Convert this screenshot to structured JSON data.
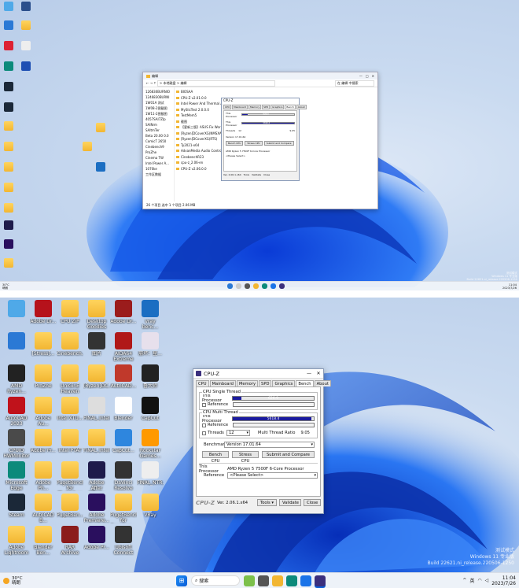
{
  "top_screen": {
    "explorer": {
      "title": "编辑",
      "breadcrumb": "> 本地磁盘 > 编辑",
      "search": "在 编辑 中搜索",
      "status": "26 个项目 选中 1 个项目 2.06 MB",
      "folders": [
        "BIOSAA",
        "CPU-Z v2.01.0.0",
        "Intel Power And Thermal Analysis Tool",
        "MySlicTest 2.0.0.0",
        "TestMem5",
        "截图",
        "【更新三版】ASUS Fix Workspace",
        "[Ryzen]DCoverXG(NMSXAfterburner)",
        "[Ryzen]DCoverXG(RTS)",
        "Ty2021-x64",
        "AdvanMedia Audio Control Panel",
        "CinebenchR23",
        "cpu-z_2.06-en",
        "CPU-Z v2.06.0.0"
      ],
      "sidebar": [
        "126830BURNIO",
        "1246830BURNI",
        "1W01A 测试",
        "1W08-2图截图",
        "1W11-2图截图",
        "4057SAI7ZIp",
        "SAlNrm",
        "SAltmTer",
        "Beta 20.00 0.0",
        "ComicT 2650",
        "Cinebench9",
        "ProZhe",
        "Cinema TW",
        "Intel Power A...",
        "1070ke",
        "工作区数据"
      ]
    },
    "mini_cpuz": {
      "title": "CPU-Z",
      "tabs": [
        "CPU",
        "Mainboard",
        "Memory",
        "SPD",
        "Graphics",
        "Bench",
        "About"
      ],
      "single_value": "626.9",
      "multi_value": "5816.4",
      "threads": "12",
      "ratio": "9.05",
      "benchmark": "Version 17.01.64",
      "buttons": [
        "Bench CPU",
        "Stress CPU",
        "Submit and Compare"
      ],
      "processor": "AMD Ryzen 5 7500F 6-Core Processor",
      "reference": "<Please Select>",
      "version": "Ver. 2.06.1.x64",
      "tools": "Tools",
      "validate": "Validate",
      "close": "Close"
    },
    "watermark": {
      "line1": "测试模式",
      "line2": "Windows 11 专业版",
      "line3": "Build 22621.ni_release.220506-1250"
    },
    "clock": {
      "time": "11:04",
      "date": "2023/7/26"
    },
    "weather": {
      "temp": "30°C",
      "desc": "晴朗"
    }
  },
  "bottom_screen": {
    "desktop_icons": [
      {
        "label": "",
        "color": "#4fa9e8"
      },
      {
        "label": "Adobe Dr...",
        "color": "#b6121b"
      },
      {
        "label": "CPU ZIP",
        "color": "folder"
      },
      {
        "label": "Desktop Goodies",
        "color": "folder"
      },
      {
        "label": "Adobe Dr...",
        "color": "#9b1c1c"
      },
      {
        "label": "vray benc...",
        "color": "#1b6ec2"
      },
      {
        "label": "",
        "color": "#2b79d5"
      },
      {
        "label": "[Stress]...",
        "color": "folder"
      },
      {
        "label": "Cinebench...",
        "color": "folder"
      },
      {
        "label": "图片",
        "color": "#333"
      },
      {
        "label": "AIDA64 Extreme",
        "color": "#b01818"
      },
      {
        "label": "崩坏：星...",
        "color": "#e7e0ec"
      },
      {
        "label": "AMD Ryzen...",
        "color": "#222"
      },
      {
        "label": "ProZhe",
        "color": "folder"
      },
      {
        "label": "UniGinE Heaven",
        "color": "folder"
      },
      {
        "label": "[Ryzen]DC...",
        "color": "folder"
      },
      {
        "label": "AutoCAD...",
        "color": "#c0392b"
      },
      {
        "label": "鲁大师",
        "color": "#222"
      },
      {
        "label": "AutoCAD 2023",
        "color": "#c0121b"
      },
      {
        "label": "Adobe Au...",
        "color": "folder"
      },
      {
        "label": "Intel XTU...",
        "color": "folder"
      },
      {
        "label": "FINAL_Intel...",
        "color": "#ddd"
      },
      {
        "label": "Blender",
        "color": "#fff"
      },
      {
        "label": "CapCut",
        "color": "#111"
      },
      {
        "label": "CPUID HWMonitor",
        "color": "#4a4a4a"
      },
      {
        "label": "Adobe Pr...",
        "color": "folder"
      },
      {
        "label": "Intel PTAT",
        "color": "folder"
      },
      {
        "label": "FINAL_Intel...",
        "color": "folder"
      },
      {
        "label": "CapCut...",
        "color": "#2e86de"
      },
      {
        "label": "Rockstar Games...",
        "color": "#ff9900"
      },
      {
        "label": "Microsoft Edge",
        "color": "#0c8a7b"
      },
      {
        "label": "Adobe Ph...",
        "color": "folder"
      },
      {
        "label": "PugetBench for Photoshop",
        "color": "folder"
      },
      {
        "label": "Adobe After Effects 2022",
        "color": "#1e1b4b"
      },
      {
        "label": "DaVinci Resolve",
        "color": "#333"
      },
      {
        "label": "FINAL_NTR...",
        "color": "#eee"
      },
      {
        "label": "Steam",
        "color": "#1b2838"
      },
      {
        "label": "AutoCAD B...",
        "color": "folder"
      },
      {
        "label": "PugetBen...",
        "color": "folder"
      },
      {
        "label": "Adobe Premiere...",
        "color": "#2a0f5e"
      },
      {
        "label": "PugetBench for Premiere...",
        "color": "folder"
      },
      {
        "label": "VRay",
        "color": "folder"
      },
      {
        "label": "Adobe Lightroom",
        "color": "folder"
      },
      {
        "label": "Blender Ben...",
        "color": "folder"
      },
      {
        "label": "RAR Archive",
        "color": "#8b1c1c"
      },
      {
        "label": "Adobe Pr...",
        "color": "#2a0f5e"
      },
      {
        "label": "Ubisoft Connect",
        "color": "#333"
      }
    ],
    "cpuz": {
      "title": "CPU-Z",
      "tabs": [
        "CPU",
        "Mainboard",
        "Memory",
        "SPD",
        "Graphics",
        "Bench",
        "About"
      ],
      "active_tab": "Bench",
      "single_group": "CPU Single Thread",
      "multi_group": "CPU Multi Thread",
      "this_processor": "This Processor",
      "reference": "Reference",
      "single_value": "626.9",
      "single_fraction": 0.108,
      "multi_value": "5618.4",
      "multi_fraction": 0.97,
      "threads_label": "Threads",
      "threads_value": "12",
      "ratio_label": "Multi Thread Ratio",
      "ratio_value": "9.05",
      "benchmark_label": "Benchmark",
      "benchmark_value": "Version 17.01.64",
      "bench_cpu": "Bench CPU",
      "stress_cpu": "Stress CPU",
      "submit": "Submit and Compare",
      "this_processor_label": "This Processor",
      "processor_name": "AMD Ryzen 5 7500F 6-Core Processor",
      "reference_label": "Reference",
      "reference_value": "<Please Select>",
      "brand": "CPU-Z",
      "version": "Ver. 2.06.1.x64",
      "tools": "Tools",
      "validate": "Validate",
      "close": "Close"
    },
    "watermark": {
      "line1": "测试模式",
      "line2": "Windows 11 专业版",
      "line3": "Build 22621.ni_release.220506-1250"
    },
    "taskbar": {
      "weather_temp": "30°C",
      "weather_desc": "晴朗",
      "search": "搜索",
      "ime": "英",
      "time": "11:04",
      "date": "2023/7/26"
    }
  }
}
